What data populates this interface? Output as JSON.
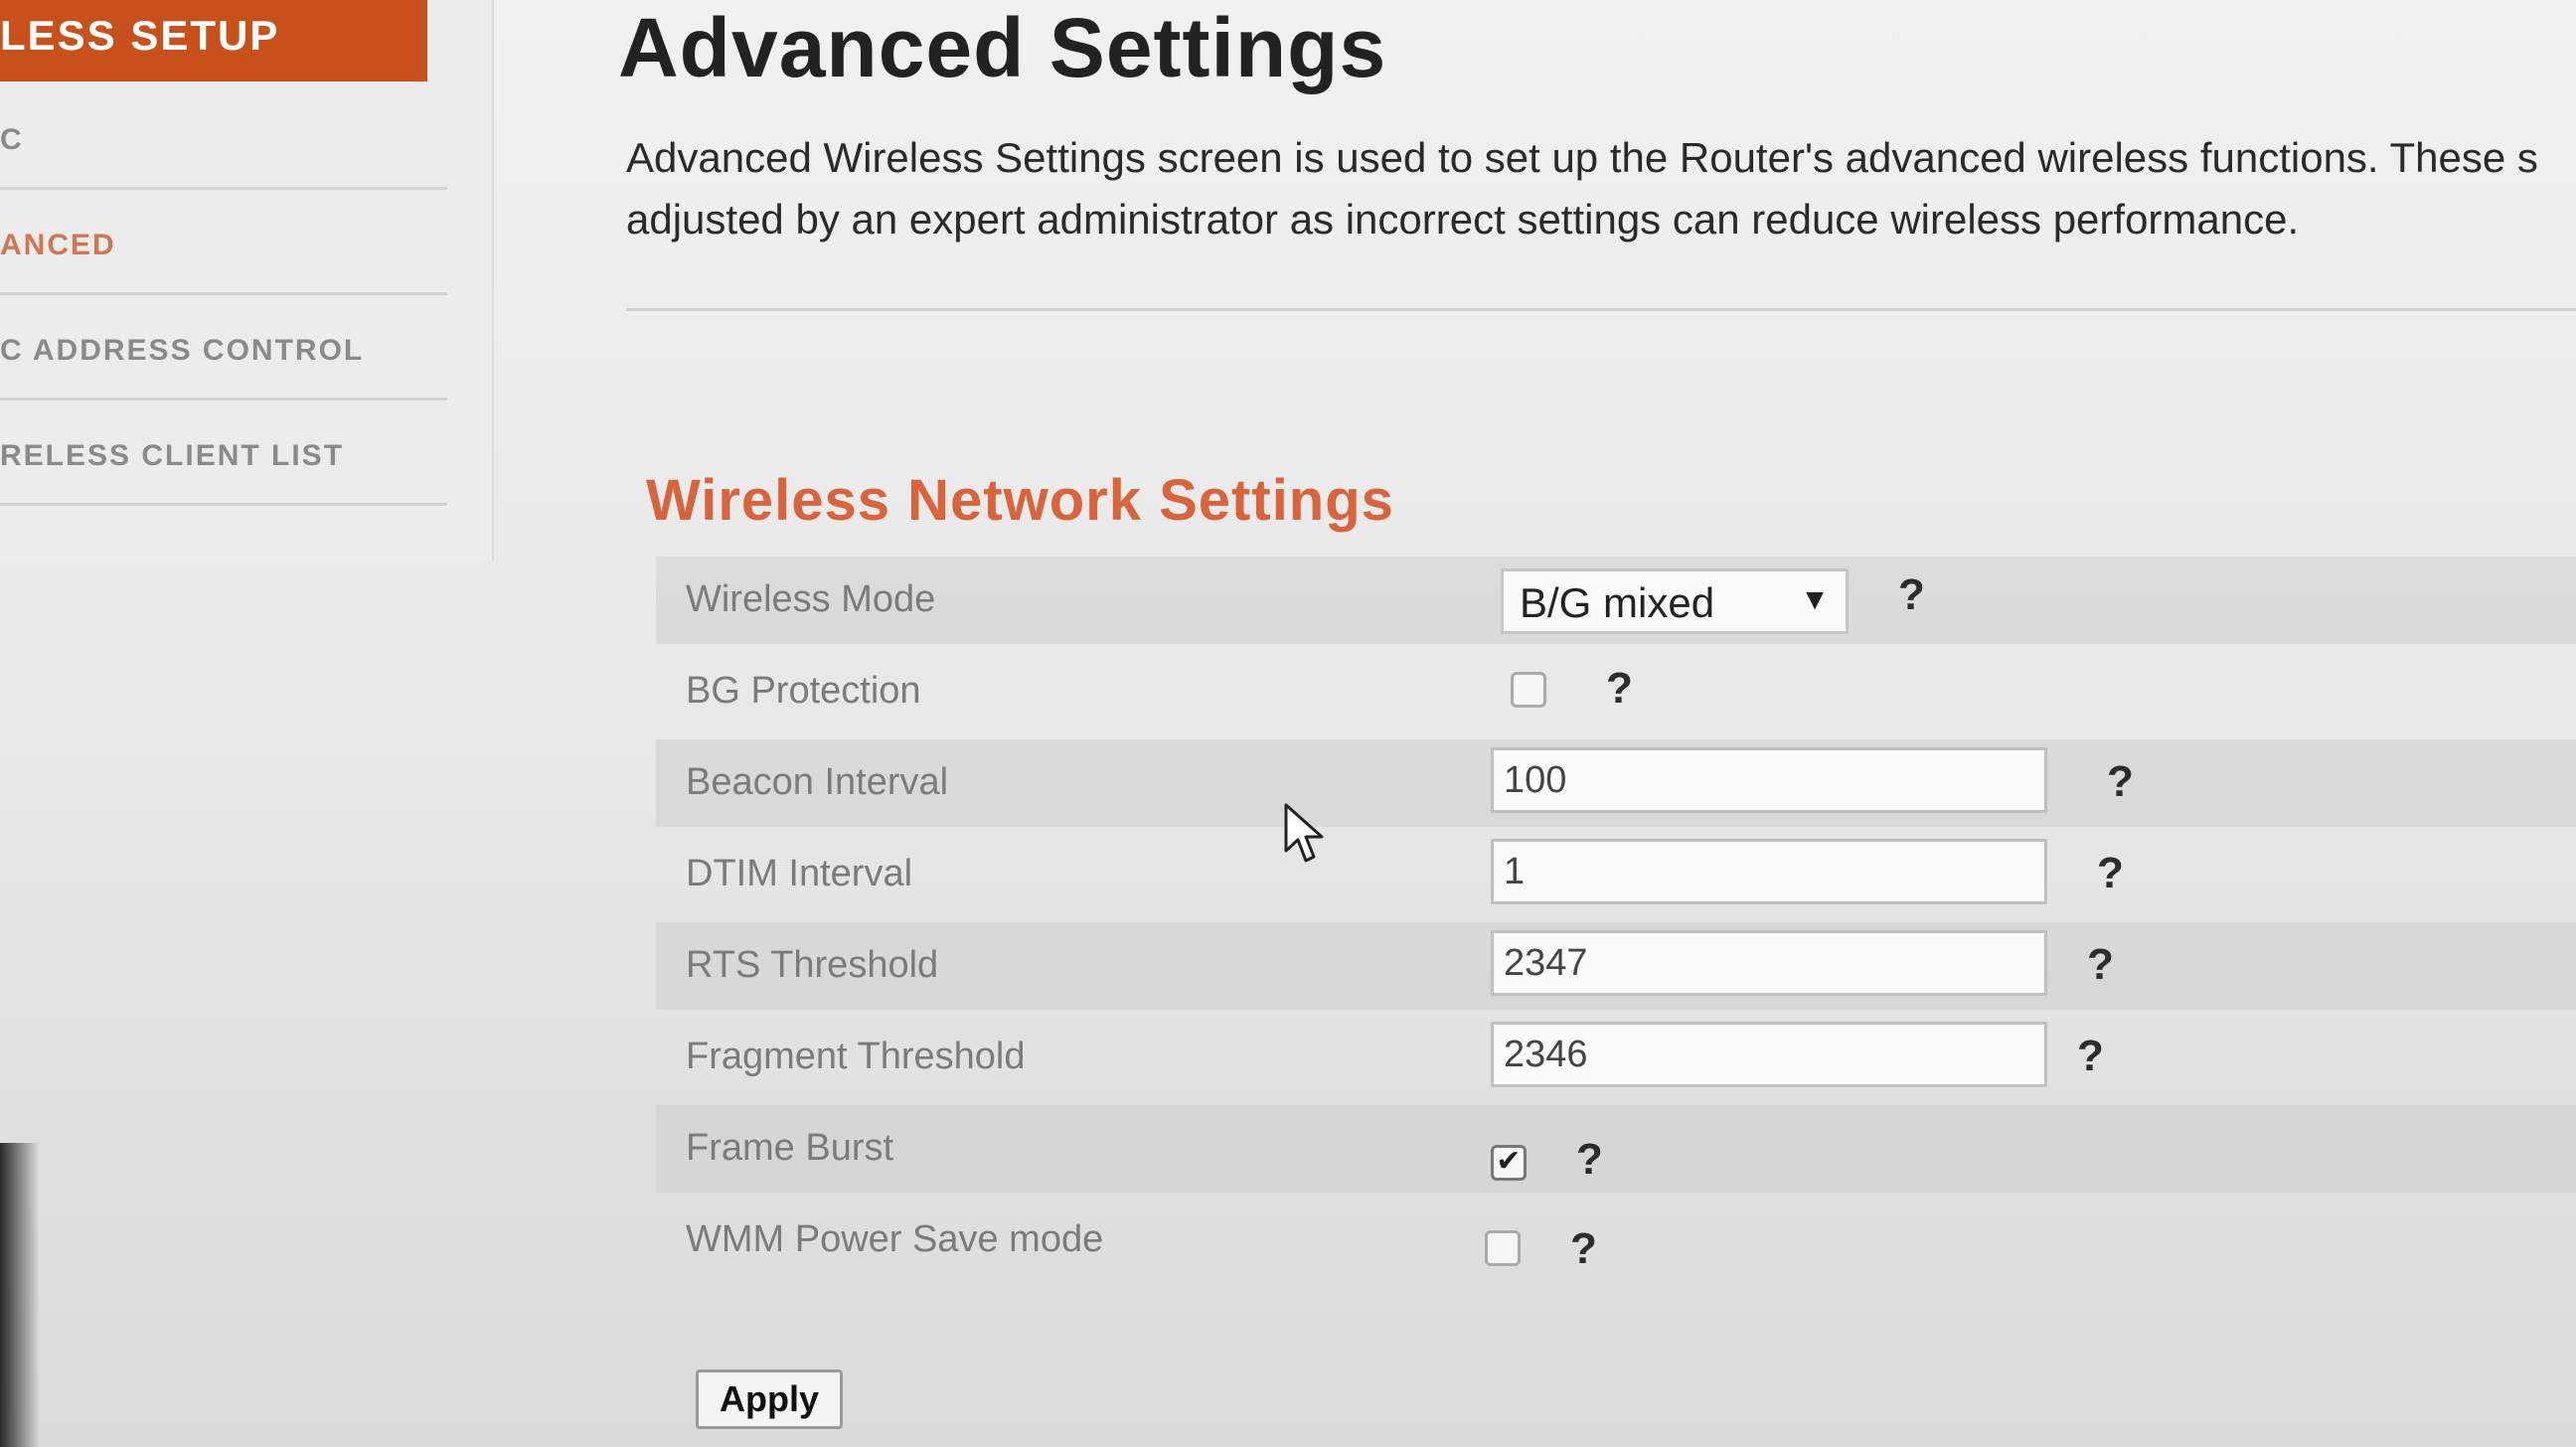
{
  "sidebar": {
    "header": "LESS SETUP",
    "items": [
      {
        "label": "C"
      },
      {
        "label": "ANCED"
      },
      {
        "label": "C ADDRESS CONTROL"
      },
      {
        "label": "RELESS CLIENT LIST"
      }
    ]
  },
  "main": {
    "title": "Advanced Settings",
    "intro_line1": "Advanced Wireless Settings screen is used to set up the Router's advanced wireless functions. These s",
    "intro_line2": "adjusted by an expert administrator as incorrect settings can reduce wireless performance.",
    "section_title": "Wireless Network Settings"
  },
  "settings": {
    "wireless_mode": {
      "label": "Wireless Mode",
      "value": "B/G mixed"
    },
    "bg_protection": {
      "label": "BG Protection",
      "checked": false
    },
    "beacon_interval": {
      "label": "Beacon Interval",
      "value": "100"
    },
    "dtim_interval": {
      "label": "DTIM Interval",
      "value": "1"
    },
    "rts_threshold": {
      "label": "RTS Threshold",
      "value": "2347"
    },
    "fragment_threshold": {
      "label": "Fragment Threshold",
      "value": "2346"
    },
    "frame_burst": {
      "label": "Frame Burst",
      "checked": true,
      "checkmark": "✔"
    },
    "wmm_power_save": {
      "label": "WMM Power Save mode",
      "checked": false
    }
  },
  "help_symbol": "?",
  "select_arrow": "▼",
  "apply_label": "Apply",
  "colors": {
    "sidebar_header": "#c8501b",
    "section_title": "#d9633a",
    "active_sidebar_item": "#d07650"
  },
  "icons": {
    "help": "help-icon",
    "dropdown": "chevron-down-icon",
    "cursor": "mouse-pointer-icon"
  }
}
